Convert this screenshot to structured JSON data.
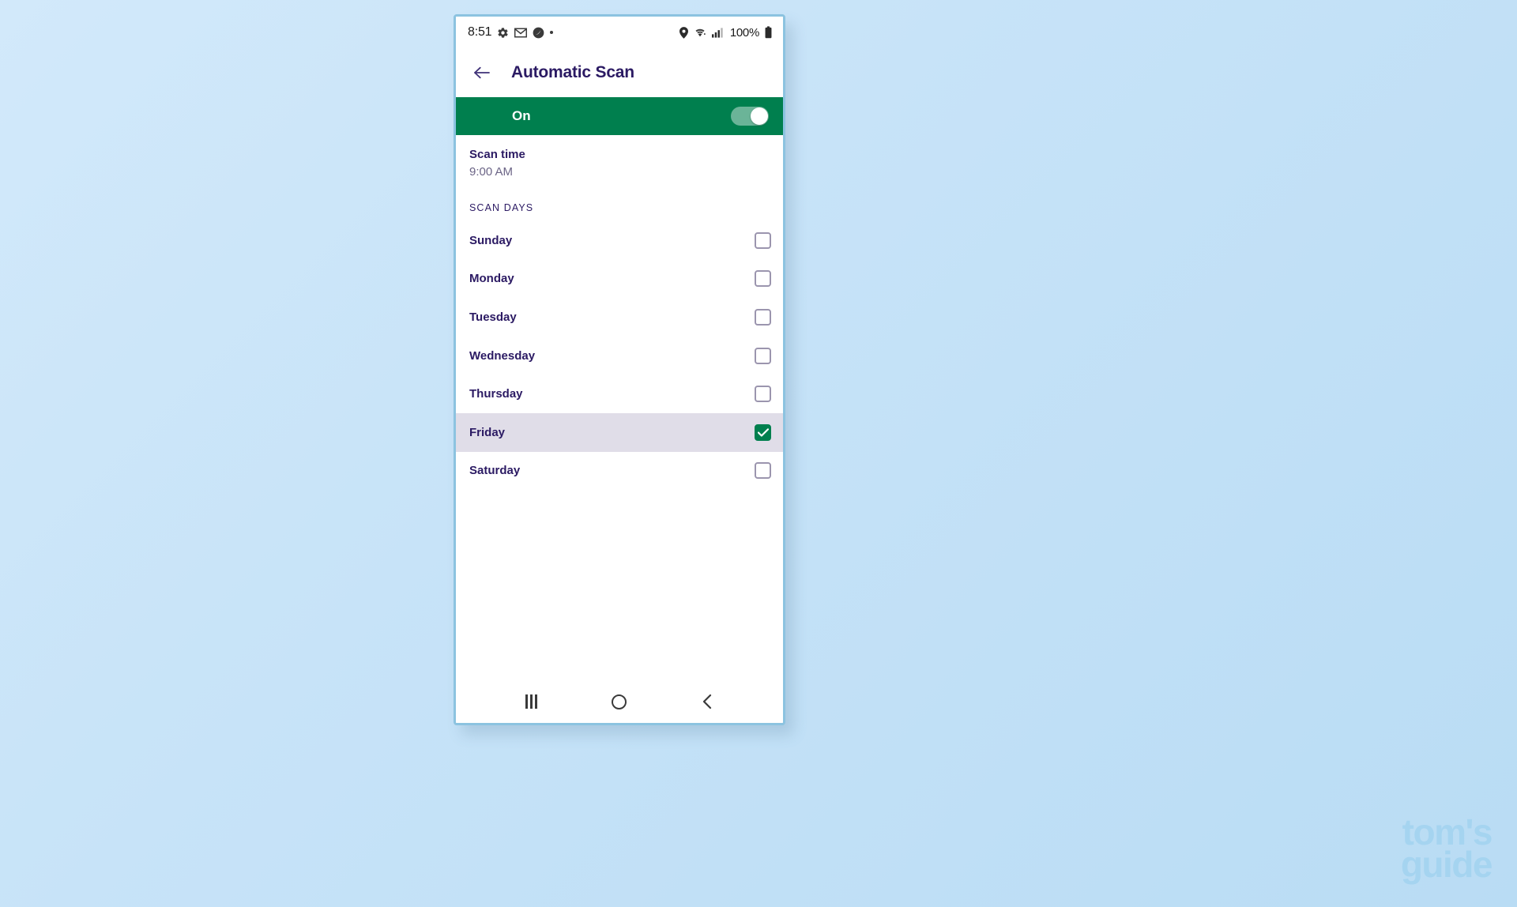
{
  "status_bar": {
    "time": "8:51",
    "battery_percent": "100%",
    "left_icons": [
      "gear-icon",
      "gmail-icon",
      "snapchat-icon",
      "dot-icon"
    ],
    "right_icons": [
      "location-pin-icon",
      "wifi-icon",
      "signal-bars-icon",
      "battery-icon"
    ]
  },
  "header": {
    "back_icon": "back-arrow-icon",
    "title": "Automatic Scan"
  },
  "toggle_bar": {
    "label": "On",
    "state": "on",
    "color": "#007f4e"
  },
  "scan_time": {
    "label": "Scan time",
    "value": "9:00 AM"
  },
  "scan_days": {
    "section_header": "SCAN DAYS",
    "days": [
      {
        "label": "Sunday",
        "checked": false
      },
      {
        "label": "Monday",
        "checked": false
      },
      {
        "label": "Tuesday",
        "checked": false
      },
      {
        "label": "Wednesday",
        "checked": false
      },
      {
        "label": "Thursday",
        "checked": false
      },
      {
        "label": "Friday",
        "checked": true
      },
      {
        "label": "Saturday",
        "checked": false
      }
    ],
    "selected_row_color": "#e0dde8",
    "checked_color": "#007f4e"
  },
  "nav_bar": {
    "recents_icon": "recents-icon",
    "home_icon": "home-icon",
    "back_icon": "nav-back-icon"
  },
  "watermark": {
    "line1": "tom's",
    "line2": "guide",
    "color": "#a5d4f0"
  }
}
